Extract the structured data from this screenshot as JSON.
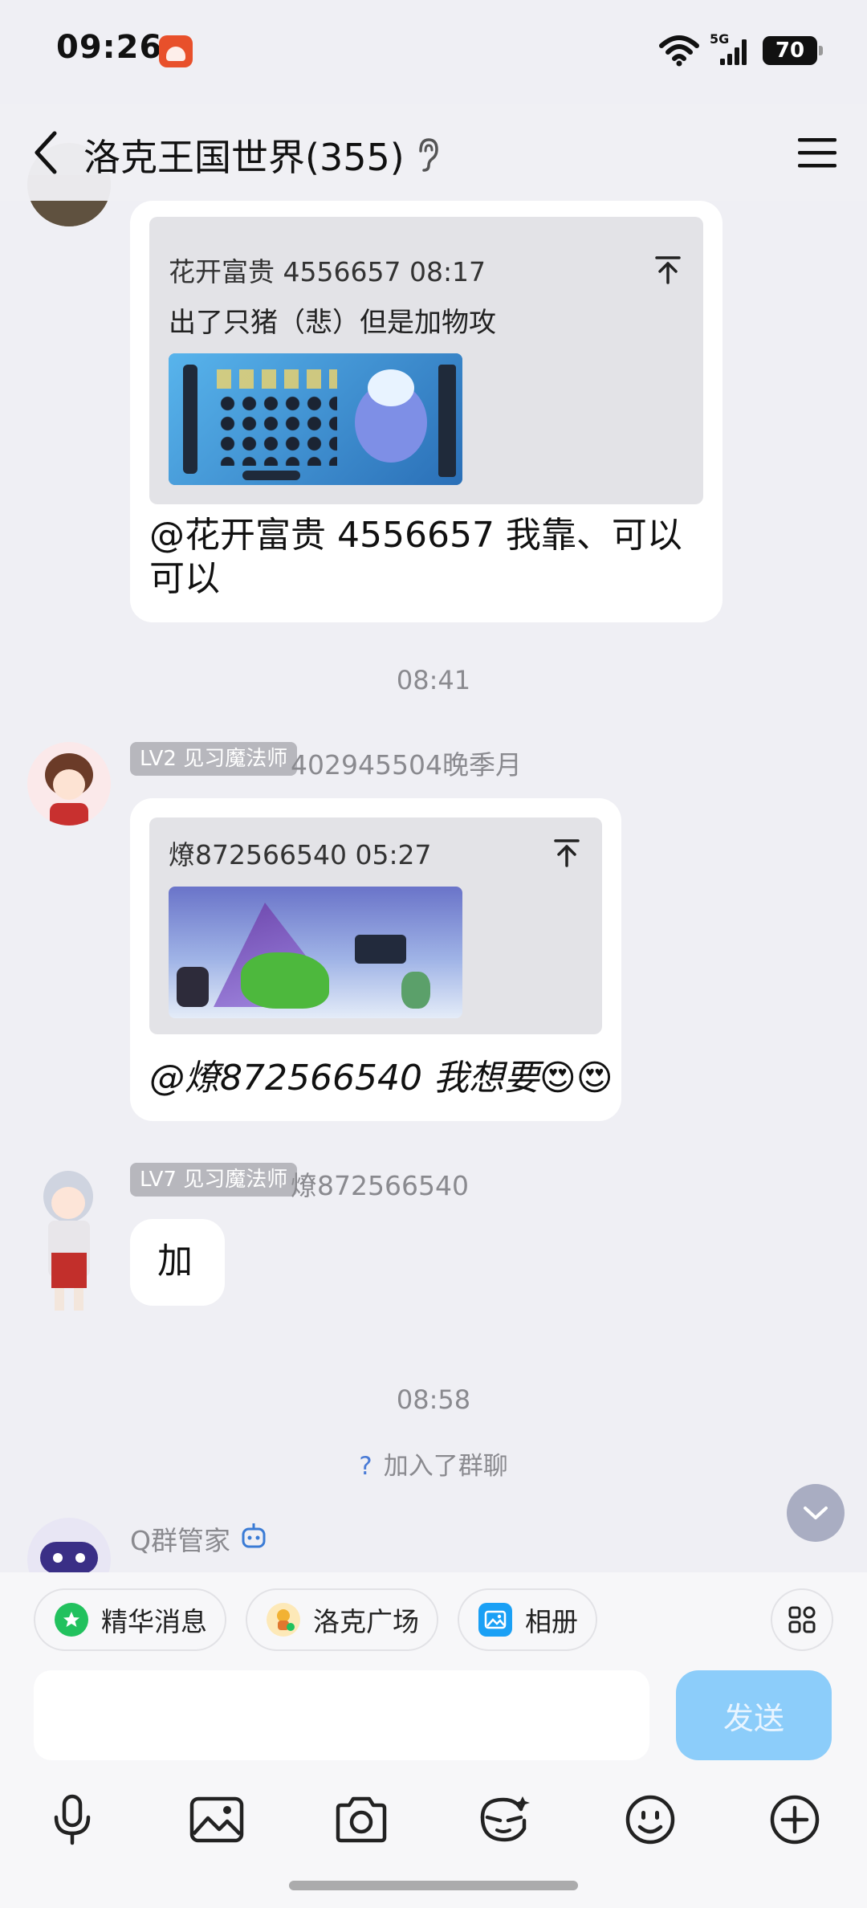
{
  "status_bar": {
    "time": "09:26",
    "network": "5G",
    "battery": "70"
  },
  "header": {
    "title": "洛克王国世界(355)"
  },
  "messages": [
    {
      "quote": {
        "meta": "花开富贵 4556657 08:17",
        "text": "出了只猪（悲）但是加物攻"
      },
      "text": "@花开富贵 4556657 我靠、可以可以"
    },
    {
      "timestamp": "08:41",
      "level": "LV2 见习魔法师",
      "sender": "402945504晚季月",
      "quote": {
        "meta": "燎872566540 05:27"
      },
      "text": "@燎872566540 我想要😍😍"
    },
    {
      "level": "LV7 见习魔法师",
      "sender": "燎872566540",
      "text": "加"
    },
    {
      "timestamp": "08:58",
      "system_text": "加入了群聊",
      "system_prefix": "?"
    },
    {
      "sender": "Q群管家"
    }
  ],
  "shortcuts": [
    {
      "label": "精华消息",
      "icon": "star-chat-icon",
      "color": "#22c15e"
    },
    {
      "label": "洛克广场",
      "icon": "roco-mascot-icon",
      "color": "#f2b233"
    },
    {
      "label": "相册",
      "icon": "photo-album-icon",
      "color": "#1aa0f5"
    }
  ],
  "composer": {
    "value": "",
    "placeholder": "",
    "send_label": "发送"
  },
  "toolbar": [
    "microphone-icon",
    "image-icon",
    "camera-icon",
    "ai-face-icon",
    "emoji-icon",
    "plus-icon"
  ],
  "colors": {
    "background": "#efeff4",
    "send_button": "#8ccdfa",
    "badge": "#b7b7bd"
  }
}
